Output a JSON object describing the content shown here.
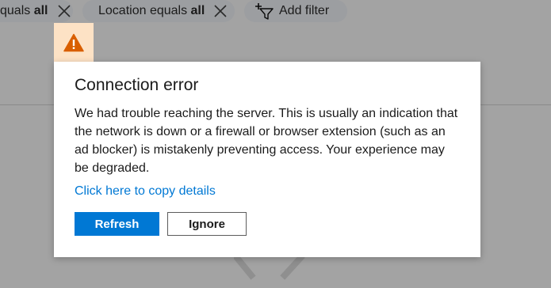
{
  "filters": [
    {
      "label": "quals ",
      "value": "all"
    },
    {
      "label": "Location equals ",
      "value": "all"
    }
  ],
  "add_filter": {
    "label": "Add filter",
    "icon": "add-filter-icon"
  },
  "dialog": {
    "icon": "warning-icon",
    "title": "Connection error",
    "body": "We had trouble reaching the server. This is usually an indication that the network is down or a firewall or browser extension (such as an ad blocker) is mistakenly preventing access. Your experience may be degraded.",
    "link": "Click here to copy details",
    "refresh_label": "Refresh",
    "ignore_label": "Ignore"
  },
  "colors": {
    "accent": "#0078d4",
    "warning": "#d95f00",
    "warning_bg": "#fde2c5"
  }
}
